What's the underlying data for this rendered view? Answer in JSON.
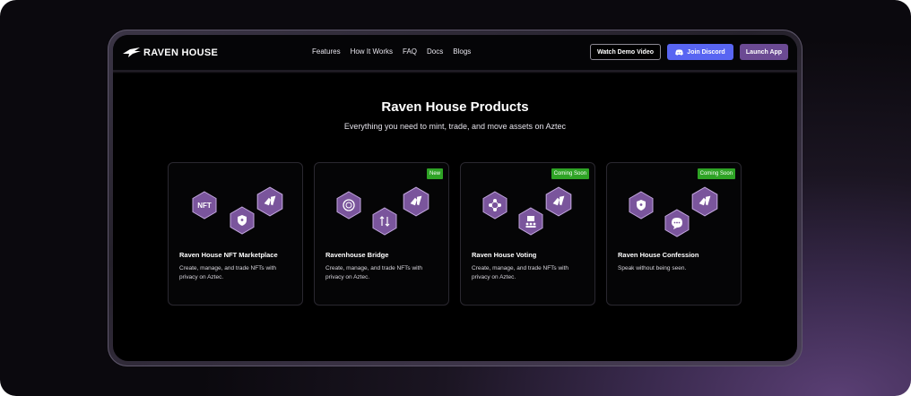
{
  "brand": {
    "name": "RAVEN HOUSE"
  },
  "nav": {
    "links": [
      "Features",
      "How It Works",
      "FAQ",
      "Docs",
      "Blogs"
    ],
    "demo_label": "Watch Demo Video",
    "discord_label": "Join Discord",
    "launch_label": "Launch App"
  },
  "hero": {
    "title": "Raven House Products",
    "subtitle": "Everything you need to mint, trade, and move assets on Aztec"
  },
  "products": [
    {
      "title": "Raven House NFT Marketplace",
      "description": "Create, manage, and trade NFTs with privacy on Aztec.",
      "badge": "",
      "icons": [
        "nft-icon",
        "shield-icon",
        "raven-icon"
      ]
    },
    {
      "title": "Ravenhouse Bridge",
      "description": "Create, manage, and trade NFTs with privacy on Aztec.",
      "badge": "New",
      "icons": [
        "coin-stack-icon",
        "transfer-arrows-icon",
        "raven-icon"
      ]
    },
    {
      "title": "Raven House Voting",
      "description": "Create, manage, and trade NFTs with privacy on Aztec.",
      "badge": "Coming Soon",
      "icons": [
        "network-icon",
        "ballot-icon",
        "raven-icon"
      ]
    },
    {
      "title": "Raven House Confession",
      "description": "Speak without being seen.",
      "badge": "Coming Soon",
      "icons": [
        "shield-icon",
        "chat-bubble-icon",
        "raven-icon"
      ]
    }
  ],
  "colors": {
    "accent_purple": "#6b4a93",
    "discord_blue": "#5865f2",
    "badge_green": "#2ea325",
    "hex_purple": "#7a559c"
  }
}
